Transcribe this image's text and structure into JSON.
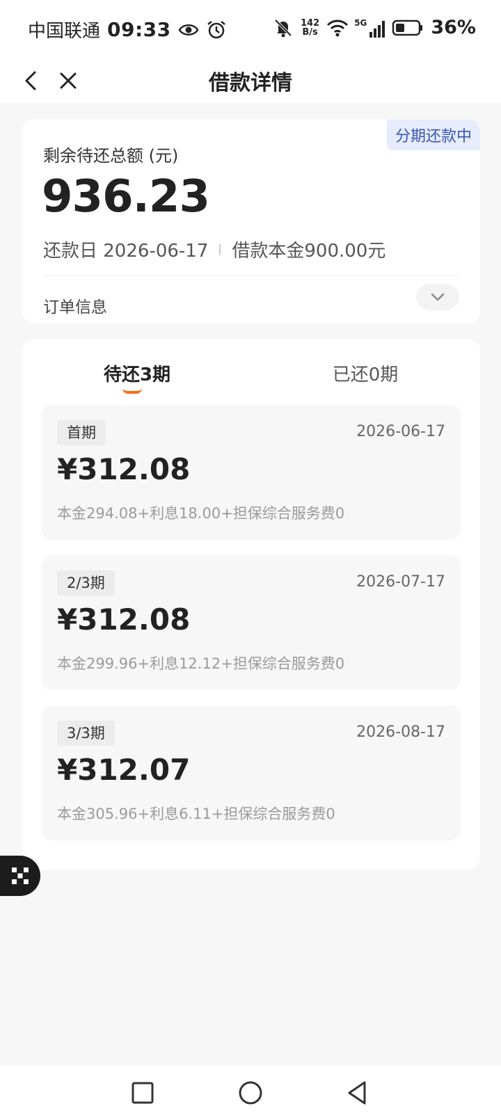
{
  "status_bar": {
    "carrier": "中国联通",
    "time": "09:33",
    "net_speed_value": "142",
    "net_speed_unit": "B/s",
    "network": "5G",
    "battery": "36%"
  },
  "nav": {
    "title": "借款详情"
  },
  "summary": {
    "status_badge": "分期还款中",
    "remaining_label": "剩余待还总额 (元)",
    "remaining_amount": "936.23",
    "repay_date": "还款日 2026-06-17",
    "principal": "借款本金900.00元",
    "order_info_label": "订单信息"
  },
  "tabs": {
    "pending": "待还3期",
    "paid": "已还0期"
  },
  "installments": [
    {
      "tag": "首期",
      "date": "2026-06-17",
      "amount": "¥312.08",
      "breakdown": "本金294.08+利息18.00+担保综合服务费0"
    },
    {
      "tag": "2/3期",
      "date": "2026-07-17",
      "amount": "¥312.08",
      "breakdown": "本金299.96+利息12.12+担保综合服务费0"
    },
    {
      "tag": "3/3期",
      "date": "2026-08-17",
      "amount": "¥312.07",
      "breakdown": "本金305.96+利息6.11+担保综合服务费0"
    }
  ],
  "colors": {
    "accent": "#ff6a1a",
    "badge_bg": "#e6ecfb",
    "badge_text": "#3a55b5",
    "page_bg": "#f7f7f7"
  }
}
